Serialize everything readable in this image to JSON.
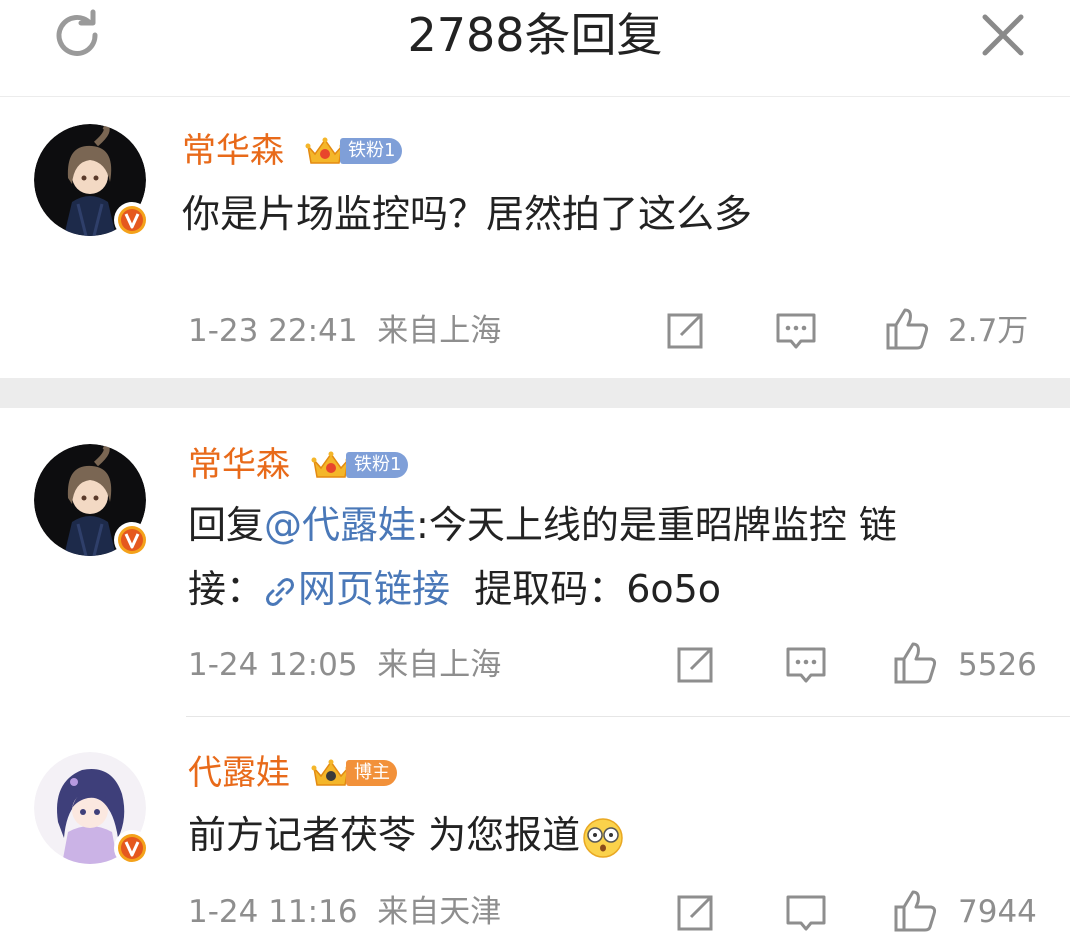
{
  "header": {
    "title": "2788条回复",
    "refresh_icon": "refresh-icon",
    "close_icon": "close-icon"
  },
  "colors": {
    "username": "#e86a1a",
    "link": "#4a78b8",
    "meta": "#8e8e8e",
    "fan_badge": "#7f9fd8",
    "blogger_badge": "#f2913a",
    "separator": "#ececec"
  },
  "comments": [
    {
      "username": "常华森",
      "badge_label": "铁粉1",
      "text": "你是片场监控吗？居然拍了这么多",
      "time": "1-23 22:41",
      "location": "来自上海",
      "likes": "2.7万"
    },
    {
      "username": "常华森",
      "badge_label": "铁粉1",
      "reply_prefix": "回复",
      "mention": "@代露娃",
      "text_after_mention": ":今天上线的是重昭牌监控 链",
      "line2_prefix": "接：",
      "link_text": "网页链接",
      "code_text": "提取码：6o5o",
      "time": "1-24 12:05",
      "location": "来自上海",
      "likes": "5526"
    },
    {
      "username": "代露娃",
      "badge_label": "博主",
      "text": "前方记者茯苓 为您报道",
      "emoji": "shocked-emoji",
      "time": "1-24 11:16",
      "location": "来自天津",
      "likes": "7944"
    }
  ]
}
